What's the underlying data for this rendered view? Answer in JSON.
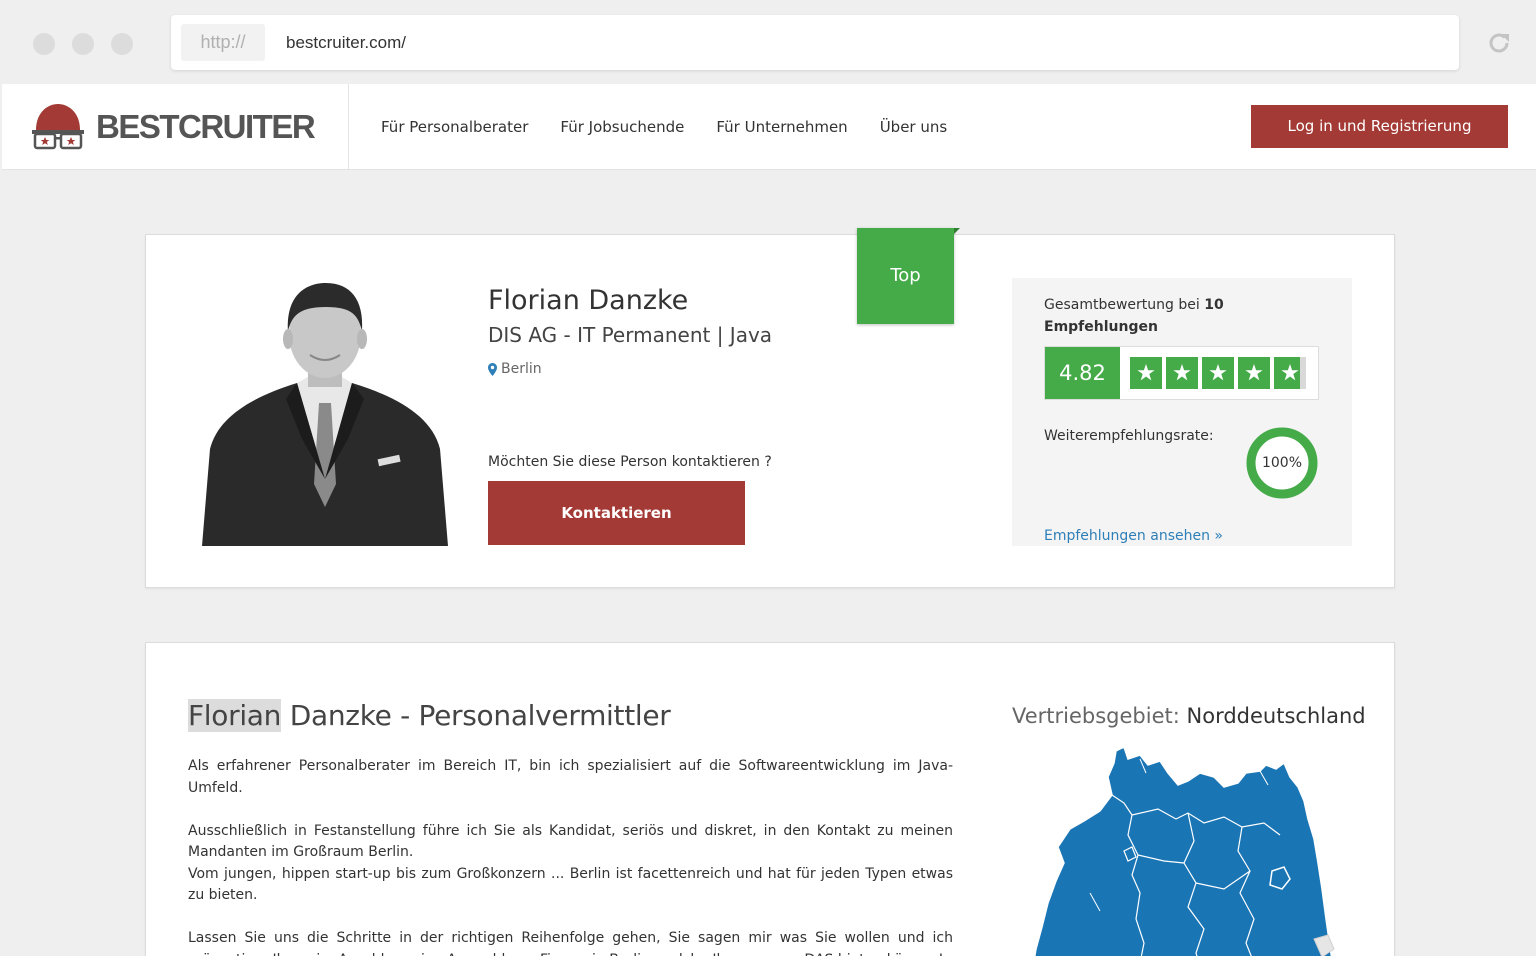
{
  "browser": {
    "protocol": "http://",
    "url": "bestcruiter.com/"
  },
  "header": {
    "logo_text": "BESTCRUITER",
    "nav": [
      {
        "label": "Für Personalberater"
      },
      {
        "label": "Für Jobsuchende"
      },
      {
        "label": "Für Unternehmen"
      },
      {
        "label": "Über uns"
      }
    ],
    "login_label": "Log in und Registrierung"
  },
  "profile": {
    "name": "Florian Danzke",
    "company": "DIS AG - IT Permanent | Java",
    "location": "Berlin",
    "contact_question": "Möchten Sie diese Person kontaktieren ?",
    "contact_button": "Kontaktieren",
    "badge": "Top"
  },
  "rating": {
    "title_prefix": "Gesamtbewertung bei",
    "count": "10",
    "title_suffix": "Empfehlungen",
    "score": "4.82",
    "stars_value": 4.82,
    "stars_max": 5,
    "recommend_label": "Weiterempfehlungsrate:",
    "recommend_rate": "100%",
    "recommend_fraction": 1.0,
    "link": "Empfehlungen ansehen »"
  },
  "about": {
    "title_first": "Florian",
    "title_rest": " Danzke - Personalvermittler",
    "p1": "Als erfahrener Personalberater im Bereich IT, bin ich spezialisiert auf die Softwareentwicklung im Java-Umfeld.",
    "p2a": "Ausschließlich in Festanstellung führe ich Sie als Kandidat, seriös und diskret, in den Kontakt zu meinen Mandanten im Großraum Berlin.",
    "p2b": "Vom jungen, hippen start-up bis zum Großkonzern ... Berlin ist facettenreich und hat für jeden Typen etwas zu bieten.",
    "p3": "Lassen Sie uns die Schritte in der richtigen Reihenfolge gehen, Sie sagen mir was Sie wollen und ich präsentiere Ihnen im Anschluss eine Auswahl von Firmen in Berlin, welche Ihnen genau DAS bieten können!"
  },
  "region": {
    "label": "Vertriebsgebiet:",
    "value": "Norddeutschland"
  },
  "colors": {
    "brand_red": "#a33a35",
    "green": "#45ab49",
    "link_blue": "#2e7fb8",
    "map_blue": "#1a75b5"
  }
}
